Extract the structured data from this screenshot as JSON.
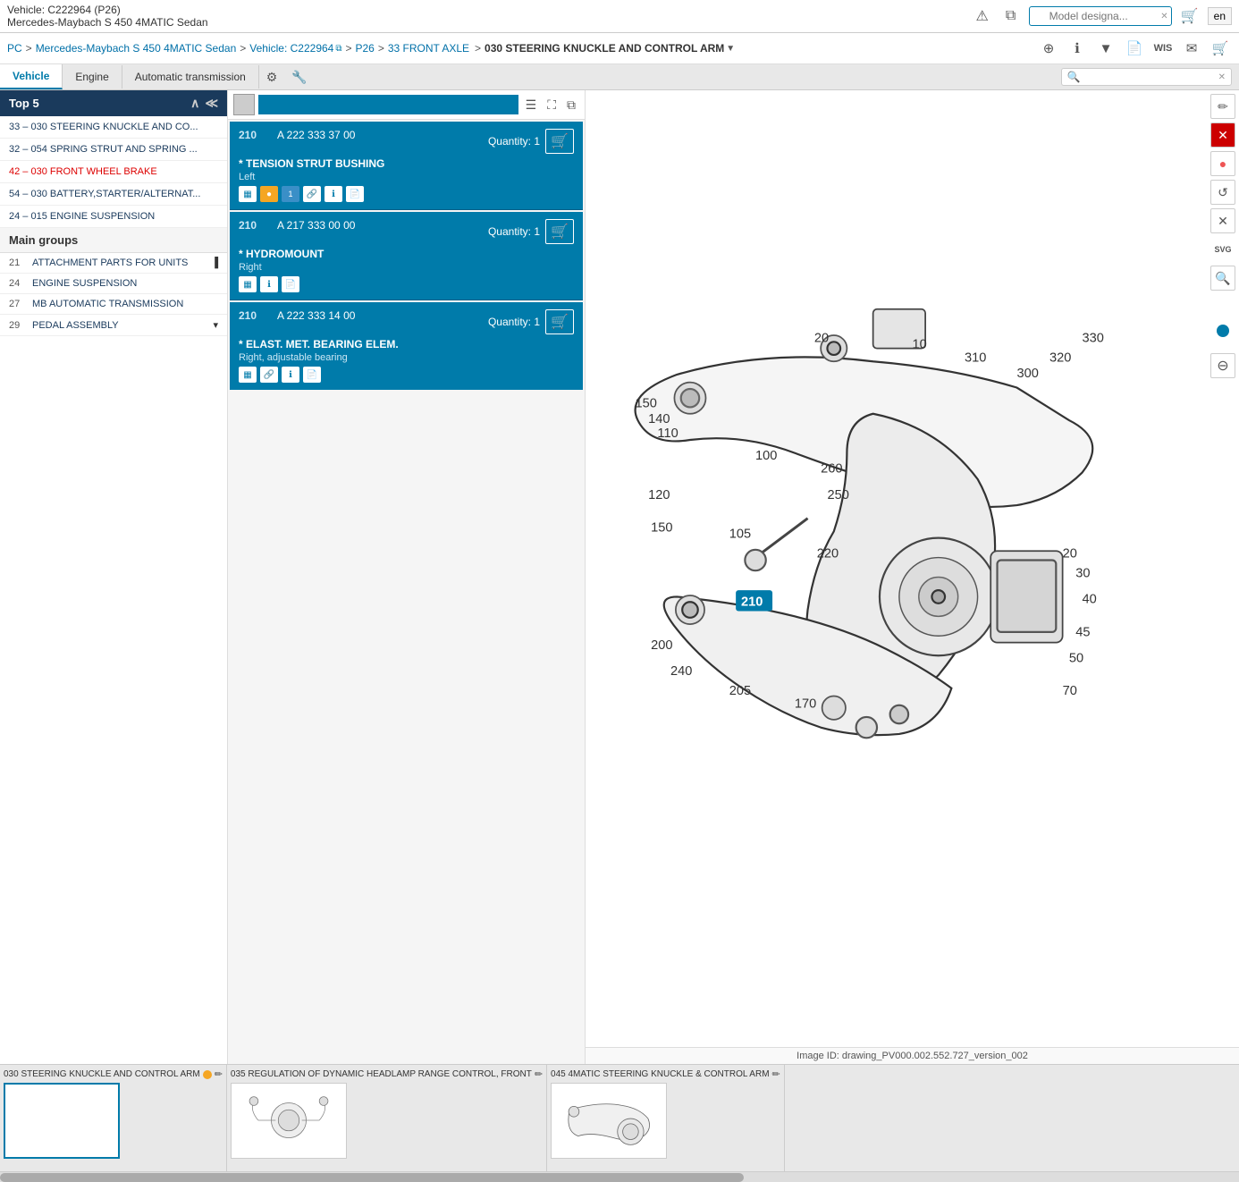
{
  "topbar": {
    "vehicle_code": "Vehicle: C222964 (P26)",
    "vehicle_name": "Mercedes-Maybach S 450 4MATIC Sedan",
    "lang": "en",
    "search_placeholder": "Model designa..."
  },
  "breadcrumb": {
    "items": [
      "PC",
      "Mercedes-Maybach S 450 4MATIC Sedan",
      "Vehicle: C222964",
      "P26",
      "33 FRONT AXLE",
      "030 STEERING KNUCKLE AND CONTROL ARM"
    ]
  },
  "toolbar_icons": {
    "zoom_in": "⊕",
    "info": "i",
    "filter": "▼",
    "doc": "📄",
    "wis": "WIS",
    "mail": "✉",
    "cart": "🛒"
  },
  "tabs": {
    "items": [
      "Vehicle",
      "Engine",
      "Automatic transmission"
    ],
    "active": 0,
    "search_placeholder": ""
  },
  "top5": {
    "label": "Top 5",
    "items": [
      "33 – 030 STEERING KNUCKLE AND CO...",
      "32 – 054 SPRING STRUT AND SPRING ...",
      "42 – 030 FRONT WHEEL BRAKE",
      "54 – 030 BATTERY,STARTER/ALTERNAT...",
      "24 – 015 ENGINE SUSPENSION"
    ]
  },
  "main_groups": {
    "label": "Main groups",
    "items": [
      {
        "num": "21",
        "label": "ATTACHMENT PARTS FOR UNITS"
      },
      {
        "num": "24",
        "label": "ENGINE SUSPENSION"
      },
      {
        "num": "27",
        "label": "MB AUTOMATIC TRANSMISSION"
      },
      {
        "num": "29",
        "label": "PEDAL ASSEMBLY"
      }
    ]
  },
  "parts": [
    {
      "pos": "210",
      "code": "A 222 333 37 00",
      "name": "* TENSION STRUT BUSHING",
      "detail": "Left",
      "qty_label": "Quantity:",
      "qty": "1",
      "icons": [
        "grid",
        "orange-dot",
        "badge1",
        "link",
        "info",
        "doc"
      ]
    },
    {
      "pos": "210",
      "code": "A 217 333 00 00",
      "name": "* HYDROMOUNT",
      "detail": "Right",
      "qty_label": "Quantity:",
      "qty": "1",
      "icons": [
        "grid",
        "info",
        "doc"
      ]
    },
    {
      "pos": "210",
      "code": "A 222 333 14 00",
      "name": "* ELAST. MET. BEARING ELEM.",
      "detail": "Right, adjustable bearing",
      "qty_label": "Quantity:",
      "qty": "1",
      "icons": [
        "grid",
        "link",
        "info",
        "doc"
      ]
    }
  ],
  "diagram": {
    "image_id": "Image ID: drawing_PV000.002.552.727_version_002",
    "highlighted_num": "210"
  },
  "thumbnails": [
    {
      "label": "030 STEERING KNUCKLE AND CONTROL ARM",
      "has_orange_dot": true,
      "active": true
    },
    {
      "label": "035 REGULATION OF DYNAMIC HEADLAMP RANGE CONTROL, FRONT",
      "has_orange_dot": false,
      "active": false
    },
    {
      "label": "045 4MATIC STEERING KNUCKLE & CONTROL ARM",
      "has_orange_dot": false,
      "active": false
    }
  ]
}
